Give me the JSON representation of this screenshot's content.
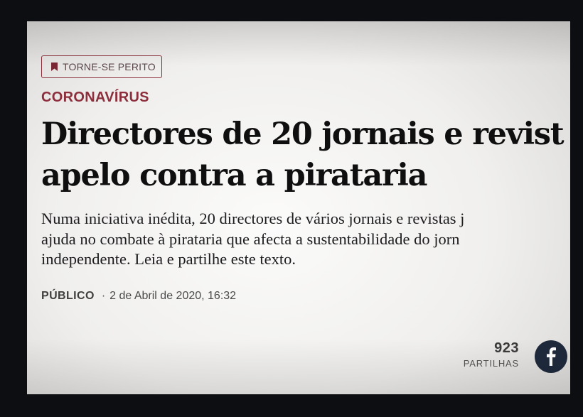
{
  "badge": {
    "label": "TORNE-SE PERITO",
    "icon": "bookmark-icon"
  },
  "article": {
    "category": "CORONAVÍRUS",
    "headline_lines": [
      "Directores de 20 jornais e revist",
      "apelo contra a pirataria"
    ],
    "lead_lines": [
      "Numa iniciativa inédita, 20 directores de vários jornais e revistas j",
      "ajuda no combate à pirataria que afecta a sustentabilidade do jorn",
      "independente. Leia e partilhe este texto."
    ],
    "source": "PÚBLICO",
    "separator": "·",
    "date": "2 de Abril de 2020, 16:32"
  },
  "shares": {
    "count": "923",
    "label": "PARTILHAS",
    "icon": "facebook-icon"
  },
  "colors": {
    "accent": "#8c2e3c",
    "facebook_button": "#1e2a3c",
    "background": "#0d0e11"
  }
}
